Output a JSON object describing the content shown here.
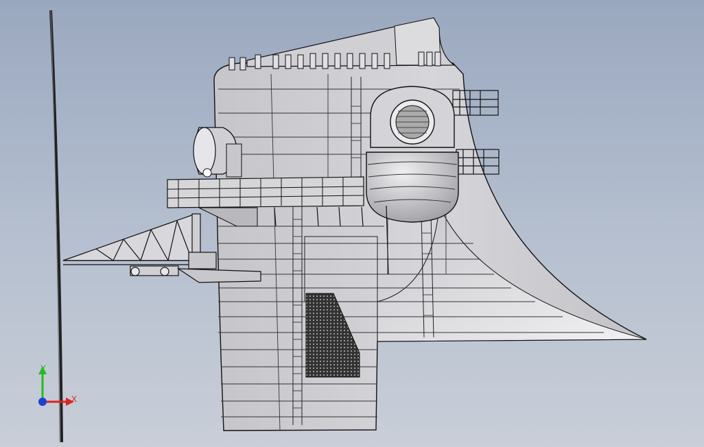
{
  "viewport": {
    "background_top": "#9aa8bf",
    "background_bottom": "#c9ced8"
  },
  "model": {
    "icon": "ship-mast-3d-model",
    "body_fill": "#c8c8cc",
    "edge_color": "#111111"
  },
  "triad": {
    "y_label": "Y",
    "x_label": "X",
    "y_color": "#22bb22",
    "x_color": "#dd2222",
    "z_color": "#1f3fd0"
  }
}
